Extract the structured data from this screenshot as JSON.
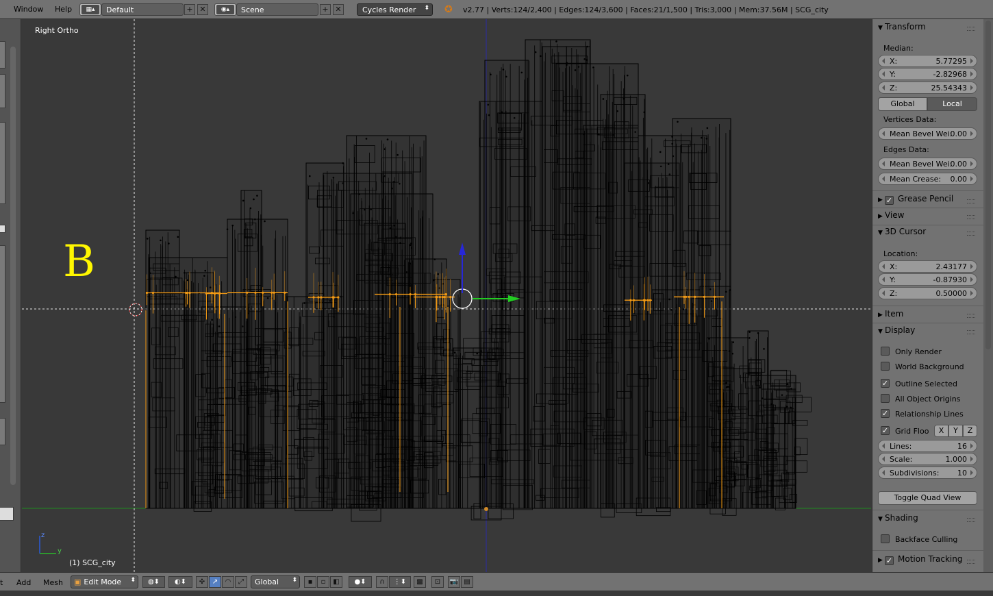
{
  "topbar": {
    "menus": [
      "Window",
      "Help"
    ],
    "layout": "Default",
    "scene": "Scene",
    "render_engine": "Cycles Render",
    "stats": "v2.77 | Verts:124/2,400 | Edges:124/3,600 | Faces:21/1,500 | Tris:3,000 | Mem:37.56M | SCG_city"
  },
  "viewport": {
    "view_name": "Right Ortho",
    "object_label": "(1) SCG_city",
    "overlay_letter": "B",
    "axis_z": "z",
    "axis_y": "y"
  },
  "npanel": {
    "transform": {
      "title": "Transform",
      "median_label": "Median:",
      "x": {
        "label": "X:",
        "value": "5.77295"
      },
      "y": {
        "label": "Y:",
        "value": "-2.82968"
      },
      "z": {
        "label": "Z:",
        "value": "25.54343"
      },
      "global_label": "Global",
      "local_label": "Local",
      "vertices_label": "Vertices Data:",
      "vert_bevel": {
        "label": "Mean Bevel Wei:",
        "value": "0.00"
      },
      "edges_label": "Edges Data:",
      "edge_bevel": {
        "label": "Mean Bevel Wei:",
        "value": "0.00"
      },
      "crease": {
        "label": "Mean Crease:",
        "value": "0.00"
      }
    },
    "grease_pencil": "Grease Pencil",
    "view": "View",
    "cursor": {
      "title": "3D Cursor",
      "location_label": "Location:",
      "x": {
        "label": "X:",
        "value": "2.43177"
      },
      "y": {
        "label": "Y:",
        "value": "-0.87930"
      },
      "z": {
        "label": "Z:",
        "value": "0.50000"
      }
    },
    "item": "Item",
    "display": {
      "title": "Display",
      "only_render": "Only Render",
      "world_background": "World Background",
      "outline_selected": "Outline Selected",
      "all_object_origins": "All Object Origins",
      "relationship_lines": "Relationship Lines",
      "grid_floor": "Grid Floo",
      "grid_x": "X",
      "grid_y": "Y",
      "grid_z": "Z",
      "lines": {
        "label": "Lines:",
        "value": "16"
      },
      "scale": {
        "label": "Scale:",
        "value": "1.000"
      },
      "subdivisions": {
        "label": "Subdivisions:",
        "value": "10"
      },
      "toggle_quad": "Toggle Quad View"
    },
    "shading": {
      "title": "Shading",
      "backface_culling": "Backface Culling"
    },
    "motion_tracking": "Motion Tracking"
  },
  "bottombar": {
    "menu_view_fragment": "t",
    "menu_add": "Add",
    "menu_mesh": "Mesh",
    "mode": "Edit Mode",
    "orientation": "Global"
  },
  "colors": {
    "selected_orange": "#f39a14",
    "wire_black": "#000000",
    "y_axis_green": "#1f8a1f",
    "z_axis_blue": "#2a2aa8",
    "letter_yellow": "#fff700"
  }
}
